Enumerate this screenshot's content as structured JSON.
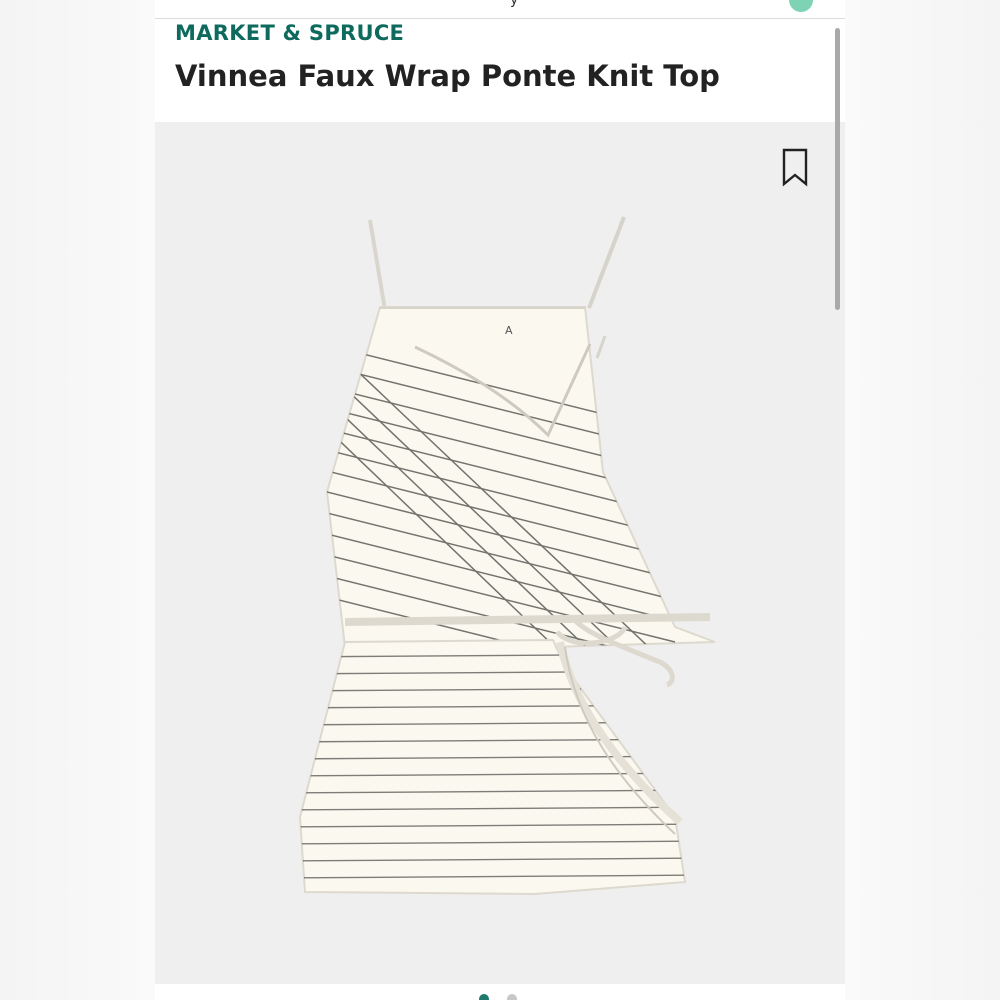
{
  "header": {
    "brand": "MARKET & SPRUCE",
    "title": "Vinnea Faux Wrap Ponte Knit Top"
  },
  "product_image": {
    "garment": "striped-wrap-cami",
    "stripe_color": "#4d4d48",
    "fabric_color": "#fbf8f0"
  },
  "carousel": {
    "total_images": 2,
    "active_index": 1
  },
  "colors": {
    "brand": "#0e6a5d",
    "image_background": "#efefef",
    "active_dot": "#1f7a6d"
  },
  "icons": {
    "bookmark": "bookmark-icon"
  }
}
